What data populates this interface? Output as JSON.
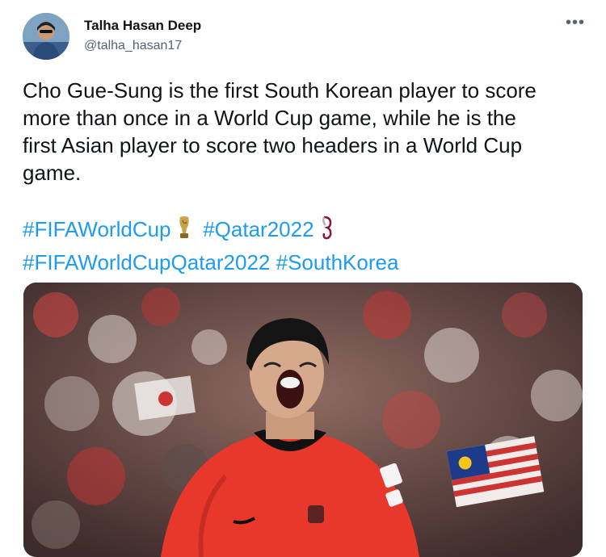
{
  "author": {
    "display_name": "Talha Hasan Deep",
    "handle": "@talha_hasan17"
  },
  "tweet": {
    "text_lines": [
      "Cho Gue-Sung is the first South Korean player to score",
      "more than once in a World Cup game, while he is the",
      "first Asian player to score two headers in a World Cup",
      "game."
    ],
    "hashtags": [
      "#FIFAWorldCup",
      "#Qatar2022",
      "#FIFAWorldCupQatar2022",
      "#SouthKorea"
    ]
  },
  "icons": {
    "more": "more-options-icon",
    "trophy": "trophy-emoji-icon",
    "qatar_emblem": "qatar2022-emblem-icon"
  },
  "colors": {
    "hashtag": "#1d9bf0",
    "secondary_text": "#536471",
    "primary_text": "#0f1419",
    "jersey": "#e8382c"
  }
}
